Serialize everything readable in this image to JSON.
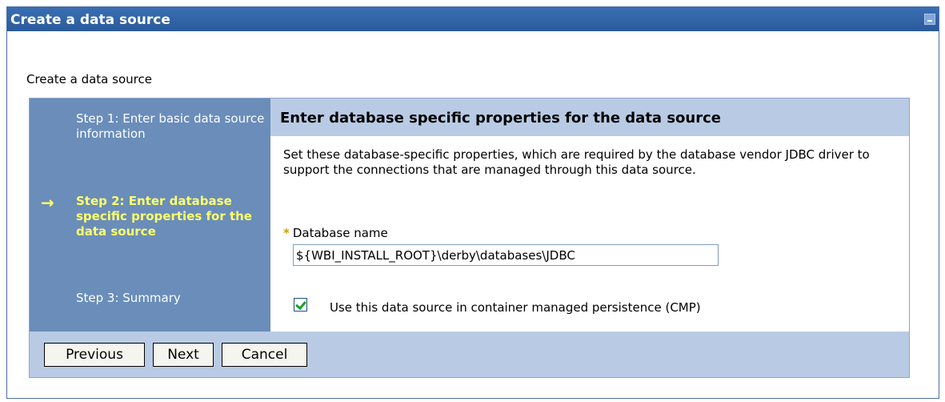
{
  "window": {
    "title": "Create a data source"
  },
  "page": {
    "subtitle": "Create a data source"
  },
  "steps": [
    {
      "label": "Step 1: Enter basic data source information",
      "current": false
    },
    {
      "label": "Step 2: Enter database specific properties for the data source",
      "current": true
    },
    {
      "label": "Step 3: Summary",
      "current": false
    }
  ],
  "current_step_arrow": "→",
  "content": {
    "heading": "Enter database specific properties for the data source",
    "description": "Set these database-specific properties, which are required by the database vendor JDBC driver to support the connections that are managed through this data source.",
    "required_marker": "*",
    "database_name_label": "Database name",
    "database_name_value": "${WBI_INSTALL_ROOT}\\derby\\databases\\JDBC",
    "cmp_checkbox_checked": true,
    "cmp_checkbox_label": "Use this data source in container managed persistence (CMP)"
  },
  "buttons": {
    "previous": "Previous",
    "next": "Next",
    "cancel": "Cancel"
  },
  "colors": {
    "title_bar": "#2f63a6",
    "steps_panel": "#6a8dba",
    "current_step": "#ffff66",
    "header_band": "#b9cbe4"
  }
}
